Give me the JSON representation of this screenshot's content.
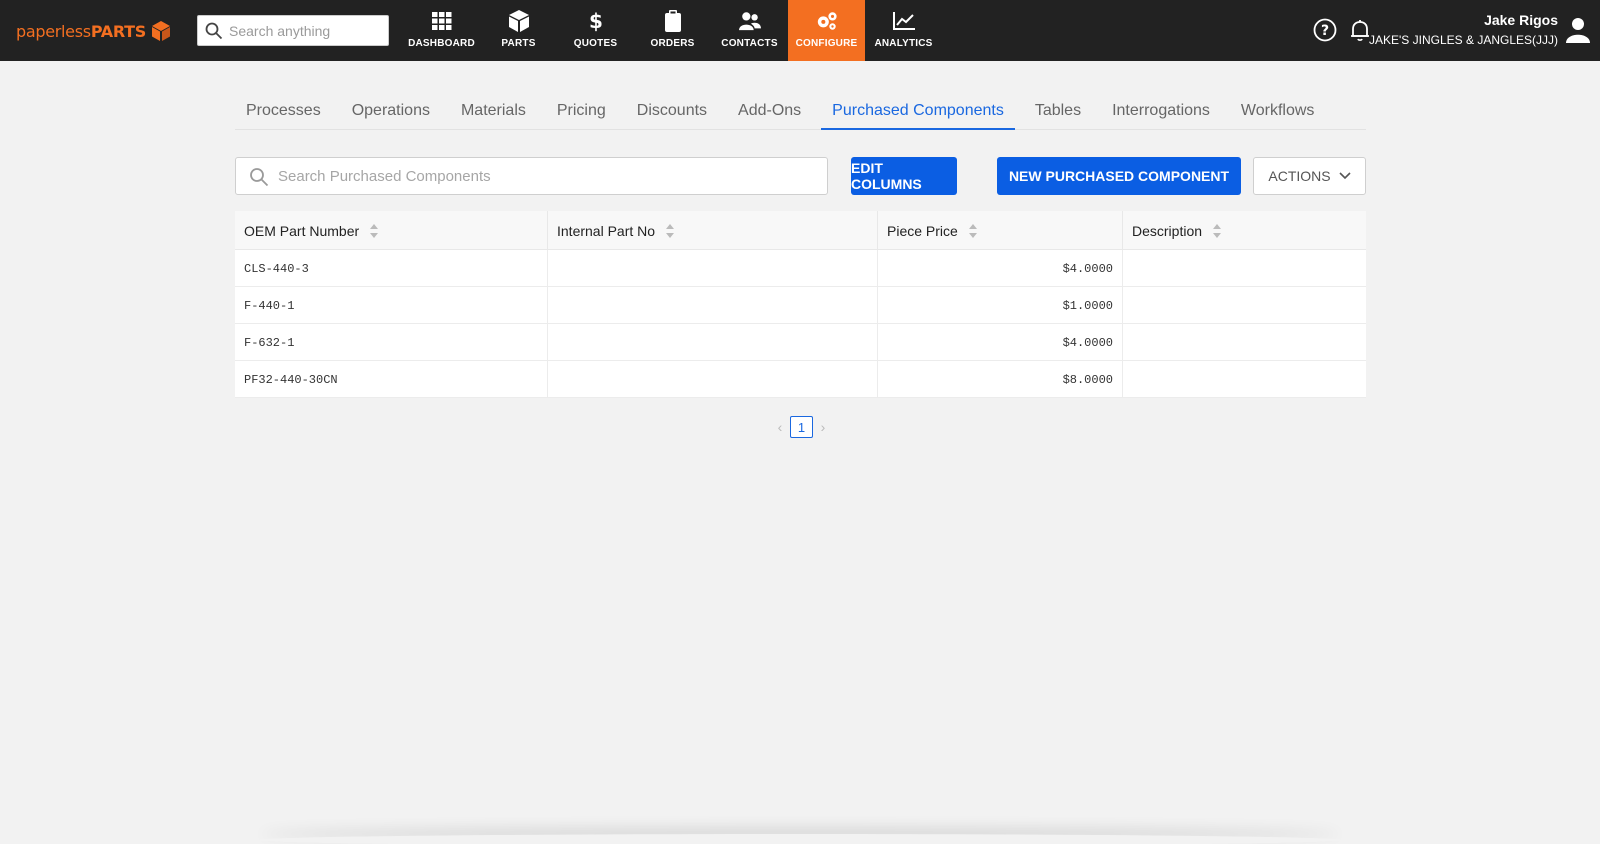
{
  "brand": {
    "name_thin": "paperless",
    "name_bold": "PARTS",
    "accent": "#f36f21"
  },
  "global_search": {
    "placeholder": "Search anything"
  },
  "nav": [
    {
      "label": "DASHBOARD",
      "icon": "grid-icon"
    },
    {
      "label": "PARTS",
      "icon": "cube-icon"
    },
    {
      "label": "QUOTES",
      "icon": "dollar-icon"
    },
    {
      "label": "ORDERS",
      "icon": "clipboard-icon"
    },
    {
      "label": "CONTACTS",
      "icon": "contacts-icon"
    },
    {
      "label": "CONFIGURE",
      "icon": "gears-icon",
      "active": true
    },
    {
      "label": "ANALYTICS",
      "icon": "chart-line-icon"
    }
  ],
  "user": {
    "name": "Jake Rigos",
    "org": "JAKE'S JINGLES & JANGLES(JJJ)"
  },
  "subtabs": [
    {
      "label": "Processes"
    },
    {
      "label": "Operations"
    },
    {
      "label": "Materials"
    },
    {
      "label": "Pricing"
    },
    {
      "label": "Discounts"
    },
    {
      "label": "Add-Ons"
    },
    {
      "label": "Purchased Components",
      "active": true
    },
    {
      "label": "Tables"
    },
    {
      "label": "Interrogations"
    },
    {
      "label": "Workflows"
    }
  ],
  "toolbar": {
    "search_placeholder": "Search Purchased Components",
    "edit_columns_label": "EDIT COLUMNS",
    "new_component_label": "NEW PURCHASED COMPONENT",
    "actions_label": "ACTIONS"
  },
  "table": {
    "columns": [
      "OEM Part Number",
      "Internal Part No",
      "Piece Price",
      "Description"
    ],
    "rows": [
      {
        "oem": "CLS-440-3",
        "internal": "",
        "price": "$4.0000",
        "description": ""
      },
      {
        "oem": "F-440-1",
        "internal": "",
        "price": "$1.0000",
        "description": ""
      },
      {
        "oem": "F-632-1",
        "internal": "",
        "price": "$4.0000",
        "description": ""
      },
      {
        "oem": "PF32-440-30CN",
        "internal": "",
        "price": "$8.0000",
        "description": ""
      }
    ]
  },
  "pagination": {
    "current_page": "1",
    "prev": "‹",
    "next": "›"
  },
  "colors": {
    "primary": "#0b5ee3",
    "topbar": "#222222",
    "link": "#1a68e0"
  }
}
